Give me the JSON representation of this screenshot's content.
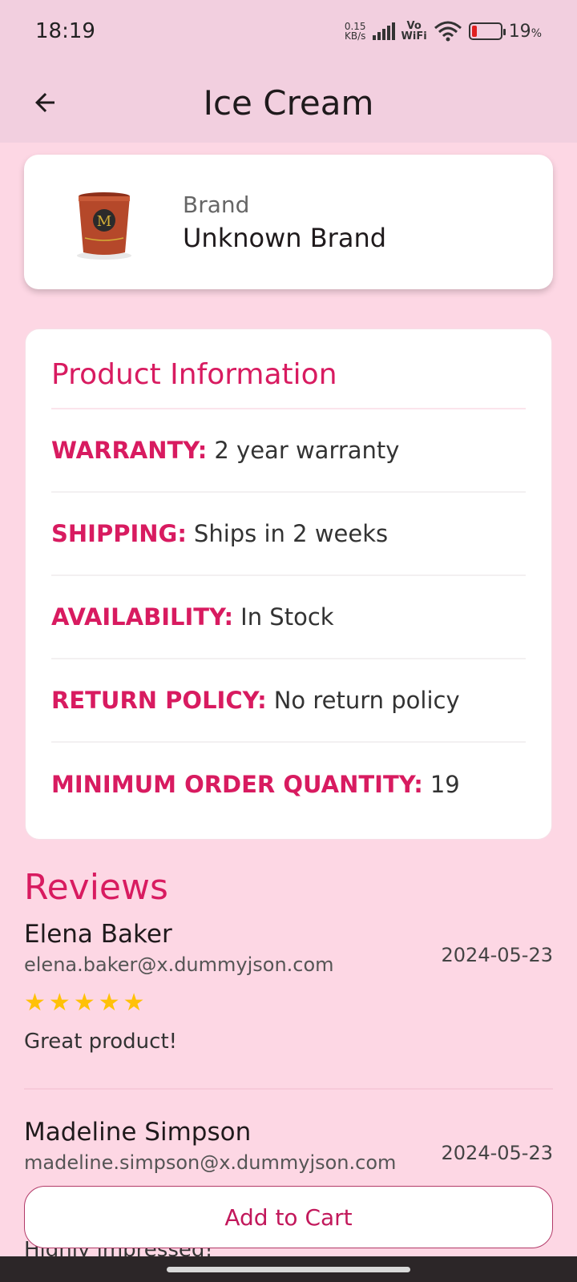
{
  "status_bar": {
    "time": "18:19",
    "net_speed_value": "0.15",
    "net_speed_unit": "KB/s",
    "vo_label": "Vo",
    "wifi_label": "WiFi",
    "battery_level": 0.19,
    "battery_pct": "19",
    "battery_unit": "%"
  },
  "app_bar": {
    "title": "Ice Cream",
    "back_icon": "arrow-left-icon"
  },
  "brand_card": {
    "label": "Brand",
    "value": "Unknown Brand"
  },
  "product_info": {
    "title": "Product Information",
    "rows": [
      {
        "key": "WARRANTY:",
        "value": "2 year warranty"
      },
      {
        "key": "SHIPPING:",
        "value": "Ships in 2 weeks"
      },
      {
        "key": "AVAILABILITY:",
        "value": "In Stock"
      },
      {
        "key": "RETURN POLICY:",
        "value": "No return policy"
      },
      {
        "key": "MINIMUM ORDER QUANTITY:",
        "value": "19"
      }
    ]
  },
  "reviews": {
    "title": "Reviews",
    "items": [
      {
        "name": "Elena Baker",
        "email": "elena.baker@x.dummyjson.com",
        "date": "2024-05-23",
        "rating": 5,
        "comment": "Great product!"
      },
      {
        "name": "Madeline Simpson",
        "email": "madeline.simpson@x.dummyjson.com",
        "date": "2024-05-23",
        "comment": "Highly impressed!"
      }
    ]
  },
  "actions": {
    "add_to_cart": "Add to Cart"
  },
  "colors": {
    "accent": "#d81b60",
    "background": "#fdd7e4",
    "app_bar": "#f2cfdf",
    "star": "#ffc107"
  }
}
